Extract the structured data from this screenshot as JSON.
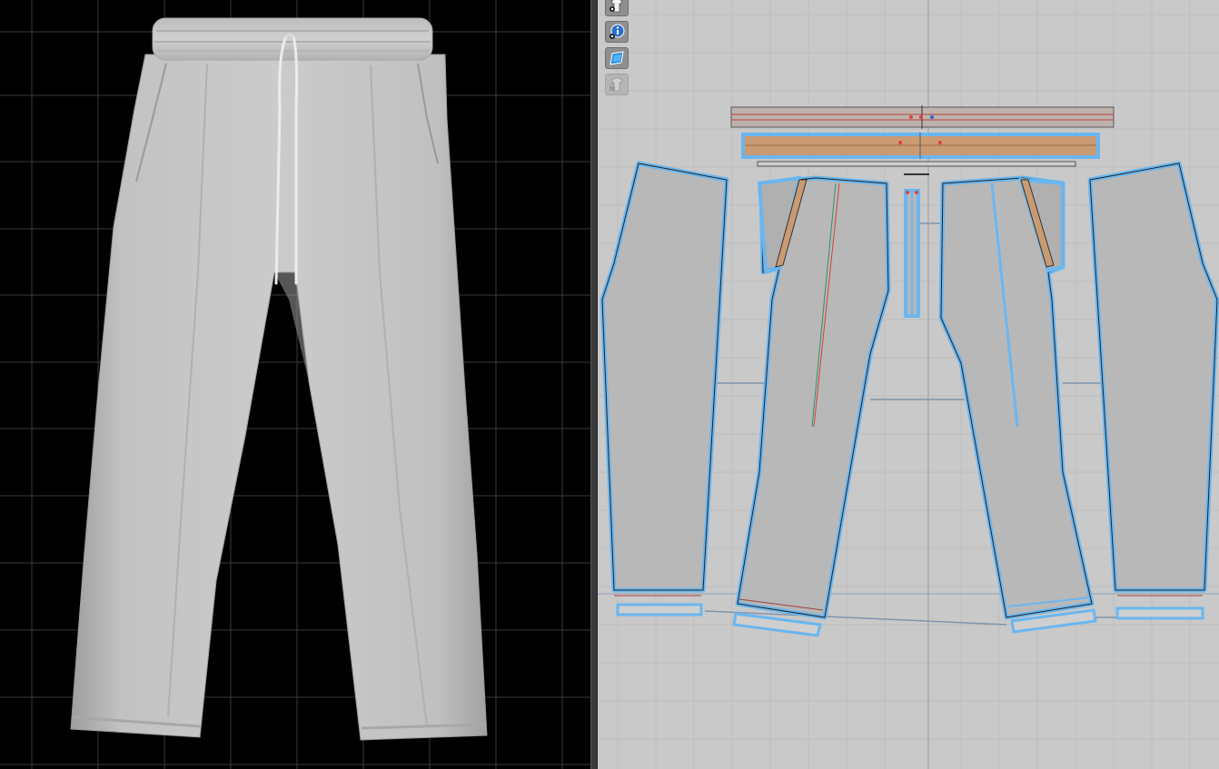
{
  "app": {
    "accent_color": "#6ab6f0",
    "viewport3d_background": "#000000",
    "viewport2d_background": "#c9c9c9"
  },
  "viewport3d": {
    "garment": "pants",
    "grid": true
  },
  "toolbar2d": {
    "tools": [
      {
        "icon": "show-avatar-icon",
        "enabled": true
      },
      {
        "icon": "show-info-icon",
        "enabled": true
      },
      {
        "icon": "show-texture-icon",
        "enabled": true
      },
      {
        "icon": "show-garment-locked-icon",
        "enabled": false
      }
    ]
  },
  "viewport2d": {
    "grid": true,
    "pieces": [
      "waistband-top",
      "waistband-bottom",
      "back-left",
      "front-left",
      "center-strip",
      "front-right",
      "back-right",
      "cuff-1",
      "cuff-2",
      "cuff-3",
      "cuff-4"
    ]
  }
}
